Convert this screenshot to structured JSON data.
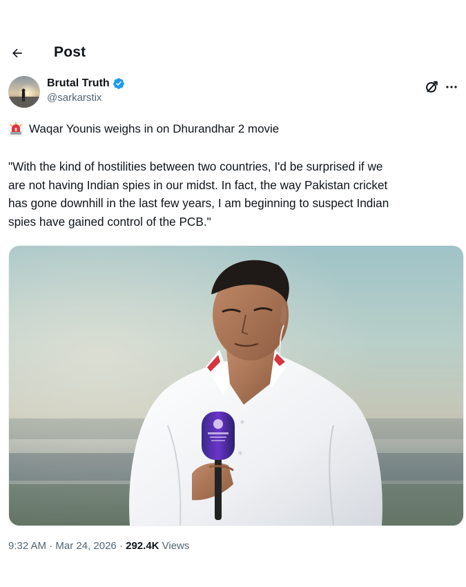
{
  "header": {
    "title": "Post"
  },
  "author": {
    "display_name": "Brutal Truth",
    "handle": "@sarkarstix",
    "verified": true
  },
  "tweet": {
    "headline": "Waqar Younis weighs in on Dhurandhar 2 movie",
    "quote": "\"With the kind of hostilities between two countries, I'd be surprised if we\nare not having Indian spies in our midst. In fact, the way Pakistan cricket\nhas gone downhill in the last few years, I am beginning to suspect Indian\nspies have gained control of the PCB.\""
  },
  "meta": {
    "time": "9:32 AM",
    "separator": "·",
    "date": "Mar 24, 2026",
    "views_count": "292.4K",
    "views_label": "Views"
  },
  "icons": {
    "back": "arrow-left-icon",
    "verified": "verified-badge-icon",
    "grok": "grok-icon",
    "more": "more-icon",
    "siren": "siren-emoji-icon"
  },
  "colors": {
    "text_primary": "#0f1419",
    "text_secondary": "#536471",
    "verified_blue": "#1d9bf0"
  }
}
